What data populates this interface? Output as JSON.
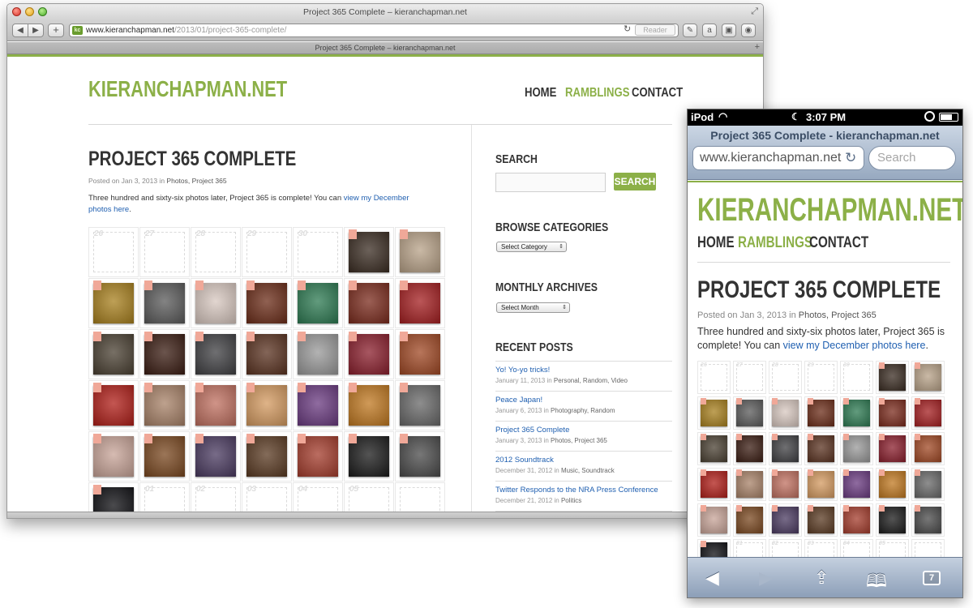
{
  "window": {
    "title": "Project 365 Complete – kieranchapman.net",
    "tab_title": "Project 365 Complete – kieranchapman.net",
    "favicon_label": "kc",
    "url_domain": "www.kieranchapman.net",
    "url_path": "/2013/01/project-365-complete/",
    "reader_label": "Reader"
  },
  "site": {
    "logo": "KIERANCHAPMAN.NET",
    "menu": {
      "home": "HOME",
      "ramblings": "RAMBLINGS",
      "contact": "CONTACT"
    },
    "accent_color": "#8cb048",
    "link_color": "#1f5fb0",
    "post": {
      "title": "PROJECT 365 COMPLETE",
      "meta_prefix": "Posted on Jan 3, 2013 in",
      "categories": "Photos, Project 365",
      "body": "Three hundred and sixty-six photos later, Project 365 is complete! You can",
      "link_text": "view my December photos here",
      "body_end": "."
    },
    "sidebar": {
      "search_heading": "SEARCH",
      "search_button": "SEARCH",
      "categories_heading": "BROWSE CATEGORIES",
      "categories_select": "Select Category",
      "archives_heading": "MONTHLY ARCHIVES",
      "archives_select": "Select Month",
      "recent_heading": "RECENT POSTS",
      "recent_posts": [
        {
          "title": "Yo! Yo-yo tricks!",
          "date": "January 11, 2013 in",
          "cats": "Personal, Random, Video"
        },
        {
          "title": "Peace Japan!",
          "date": "January 6, 2013 in",
          "cats": "Photography, Random"
        },
        {
          "title": "Project 365 Complete",
          "date": "January 3, 2013 in",
          "cats": "Photos, Project 365"
        },
        {
          "title": "2012 Soundtrack",
          "date": "December 31, 2012 in",
          "cats": "Music, Soundtrack"
        },
        {
          "title": "Twitter Responds to the NRA Press Conference",
          "date": "December 21, 2012 in",
          "cats": "Politics"
        }
      ]
    },
    "calendar": {
      "cells": [
        {
          "label": "26",
          "photo": false
        },
        {
          "label": "27",
          "photo": false
        },
        {
          "label": "28",
          "photo": false
        },
        {
          "label": "29",
          "photo": false
        },
        {
          "label": "30",
          "photo": false
        },
        {
          "label": "",
          "photo": true,
          "color": "#3a2c22"
        },
        {
          "label": "",
          "photo": true,
          "color": "#b8a288"
        },
        {
          "label": "",
          "photo": true,
          "color": "#a8801e"
        },
        {
          "label": "",
          "photo": true,
          "color": "#5a5a5a"
        },
        {
          "label": "",
          "photo": true,
          "color": "#d8c8c0"
        },
        {
          "label": "",
          "photo": true,
          "color": "#6b2c18"
        },
        {
          "label": "",
          "photo": true,
          "color": "#2d7a52"
        },
        {
          "label": "",
          "photo": true,
          "color": "#7a2a1c"
        },
        {
          "label": "",
          "photo": true,
          "color": "#a41e20"
        },
        {
          "label": "",
          "photo": true,
          "color": "#4a4032"
        },
        {
          "label": "",
          "photo": true,
          "color": "#3a1c12"
        },
        {
          "label": "",
          "photo": true,
          "color": "#3f3f42"
        },
        {
          "label": "",
          "photo": true,
          "color": "#5a3220"
        },
        {
          "label": "",
          "photo": true,
          "color": "#999999"
        },
        {
          "label": "",
          "photo": true,
          "color": "#8a1e2c"
        },
        {
          "label": "",
          "photo": true,
          "color": "#a04824"
        },
        {
          "label": "",
          "photo": true,
          "color": "#b01e18"
        },
        {
          "label": "",
          "photo": true,
          "color": "#a88268"
        },
        {
          "label": "",
          "photo": true,
          "color": "#c07060"
        },
        {
          "label": "",
          "photo": true,
          "color": "#d49a60"
        },
        {
          "label": "",
          "photo": true,
          "color": "#6a3a80"
        },
        {
          "label": "",
          "photo": true,
          "color": "#c07820"
        },
        {
          "label": "",
          "photo": true,
          "color": "#686868"
        },
        {
          "label": "",
          "photo": true,
          "color": "#c8a498"
        },
        {
          "label": "",
          "photo": true,
          "color": "#7a4820"
        },
        {
          "label": "",
          "photo": true,
          "color": "#4a3a60"
        },
        {
          "label": "",
          "photo": true,
          "color": "#5a3a22"
        },
        {
          "label": "",
          "photo": true,
          "color": "#a43c2c"
        },
        {
          "label": "",
          "photo": true,
          "color": "#1a1a1a"
        },
        {
          "label": "",
          "photo": true,
          "color": "#4a4a4a"
        },
        {
          "label": "",
          "photo": true,
          "color": "#0e0e12"
        },
        {
          "label": "01",
          "photo": false
        },
        {
          "label": "02",
          "photo": false
        },
        {
          "label": "03",
          "photo": false
        },
        {
          "label": "04",
          "photo": false
        },
        {
          "label": "05",
          "photo": false
        },
        {
          "label": "",
          "photo": false
        }
      ]
    }
  },
  "mobile": {
    "carrier": "iPod",
    "time": "3:07 PM",
    "page_title": "Project 365 Complete - kieranchapman.net",
    "url": "www.kieranchapman.net",
    "search_placeholder": "Search",
    "tabs_count": "7"
  },
  "icons": {
    "back": "◀",
    "forward": "▶",
    "add": "+",
    "reload": "↻",
    "resize": "⤢",
    "ext1": "✎",
    "ext2": "a",
    "ext3": "▣",
    "ext4": "◉",
    "wifi": "◠",
    "moon": "☾",
    "share": "⇪",
    "bookmarks": "📖"
  }
}
